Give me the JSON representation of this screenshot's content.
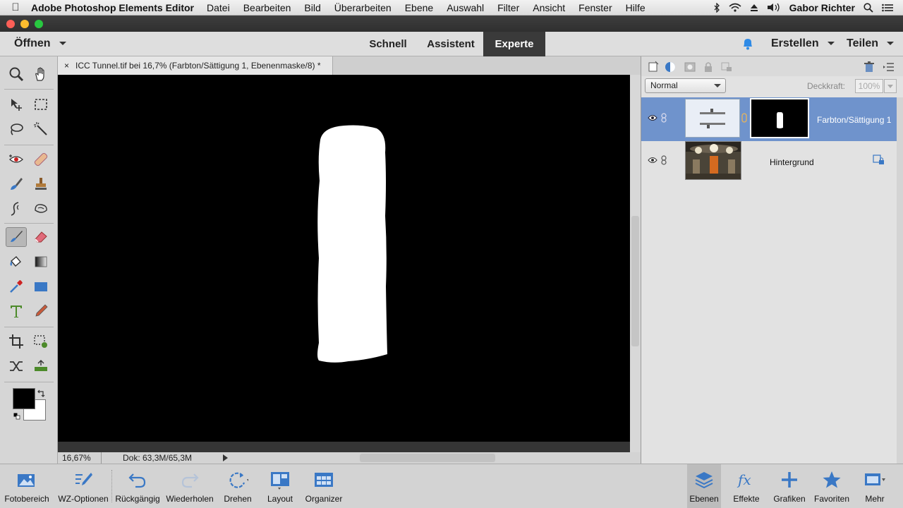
{
  "menubar": {
    "app_name": "Adobe Photoshop Elements Editor",
    "items": [
      "Datei",
      "Bearbeiten",
      "Bild",
      "Überarbeiten",
      "Ebene",
      "Auswahl",
      "Filter",
      "Ansicht",
      "Fenster",
      "Hilfe"
    ],
    "user": "Gabor Richter"
  },
  "topbar": {
    "open_label": "Öffnen",
    "modes": [
      "Schnell",
      "Assistent",
      "Experte"
    ],
    "active_mode": "Experte",
    "create_label": "Erstellen",
    "share_label": "Teilen"
  },
  "document": {
    "tab_title": "ICC Tunnel.tif bei 16,7% (Farbton/Sättigung 1, Ebenenmaske/8) *",
    "close_glyph": "×",
    "zoom": "16,67%",
    "doc_size": "Dok: 63,3M/65,3M"
  },
  "layers_panel": {
    "blend_mode": "Normal",
    "opacity_label": "Deckkraft:",
    "opacity_value": "100%",
    "layers": [
      {
        "name": "Farbton/Sättigung 1",
        "selected": true,
        "type": "adjustment"
      },
      {
        "name": "Hintergrund",
        "selected": false,
        "type": "image"
      }
    ]
  },
  "bottombar": {
    "left": [
      "Fotobereich",
      "WZ-Optionen",
      "Rückgängig",
      "Wiederholen",
      "Drehen",
      "Layout",
      "Organizer"
    ],
    "right": [
      "Ebenen",
      "Effekte",
      "Grafiken",
      "Favoriten",
      "Mehr"
    ]
  },
  "colors": {
    "accent_blue": "#6f93cc",
    "foreground": "#000000",
    "background": "#ffffff"
  }
}
